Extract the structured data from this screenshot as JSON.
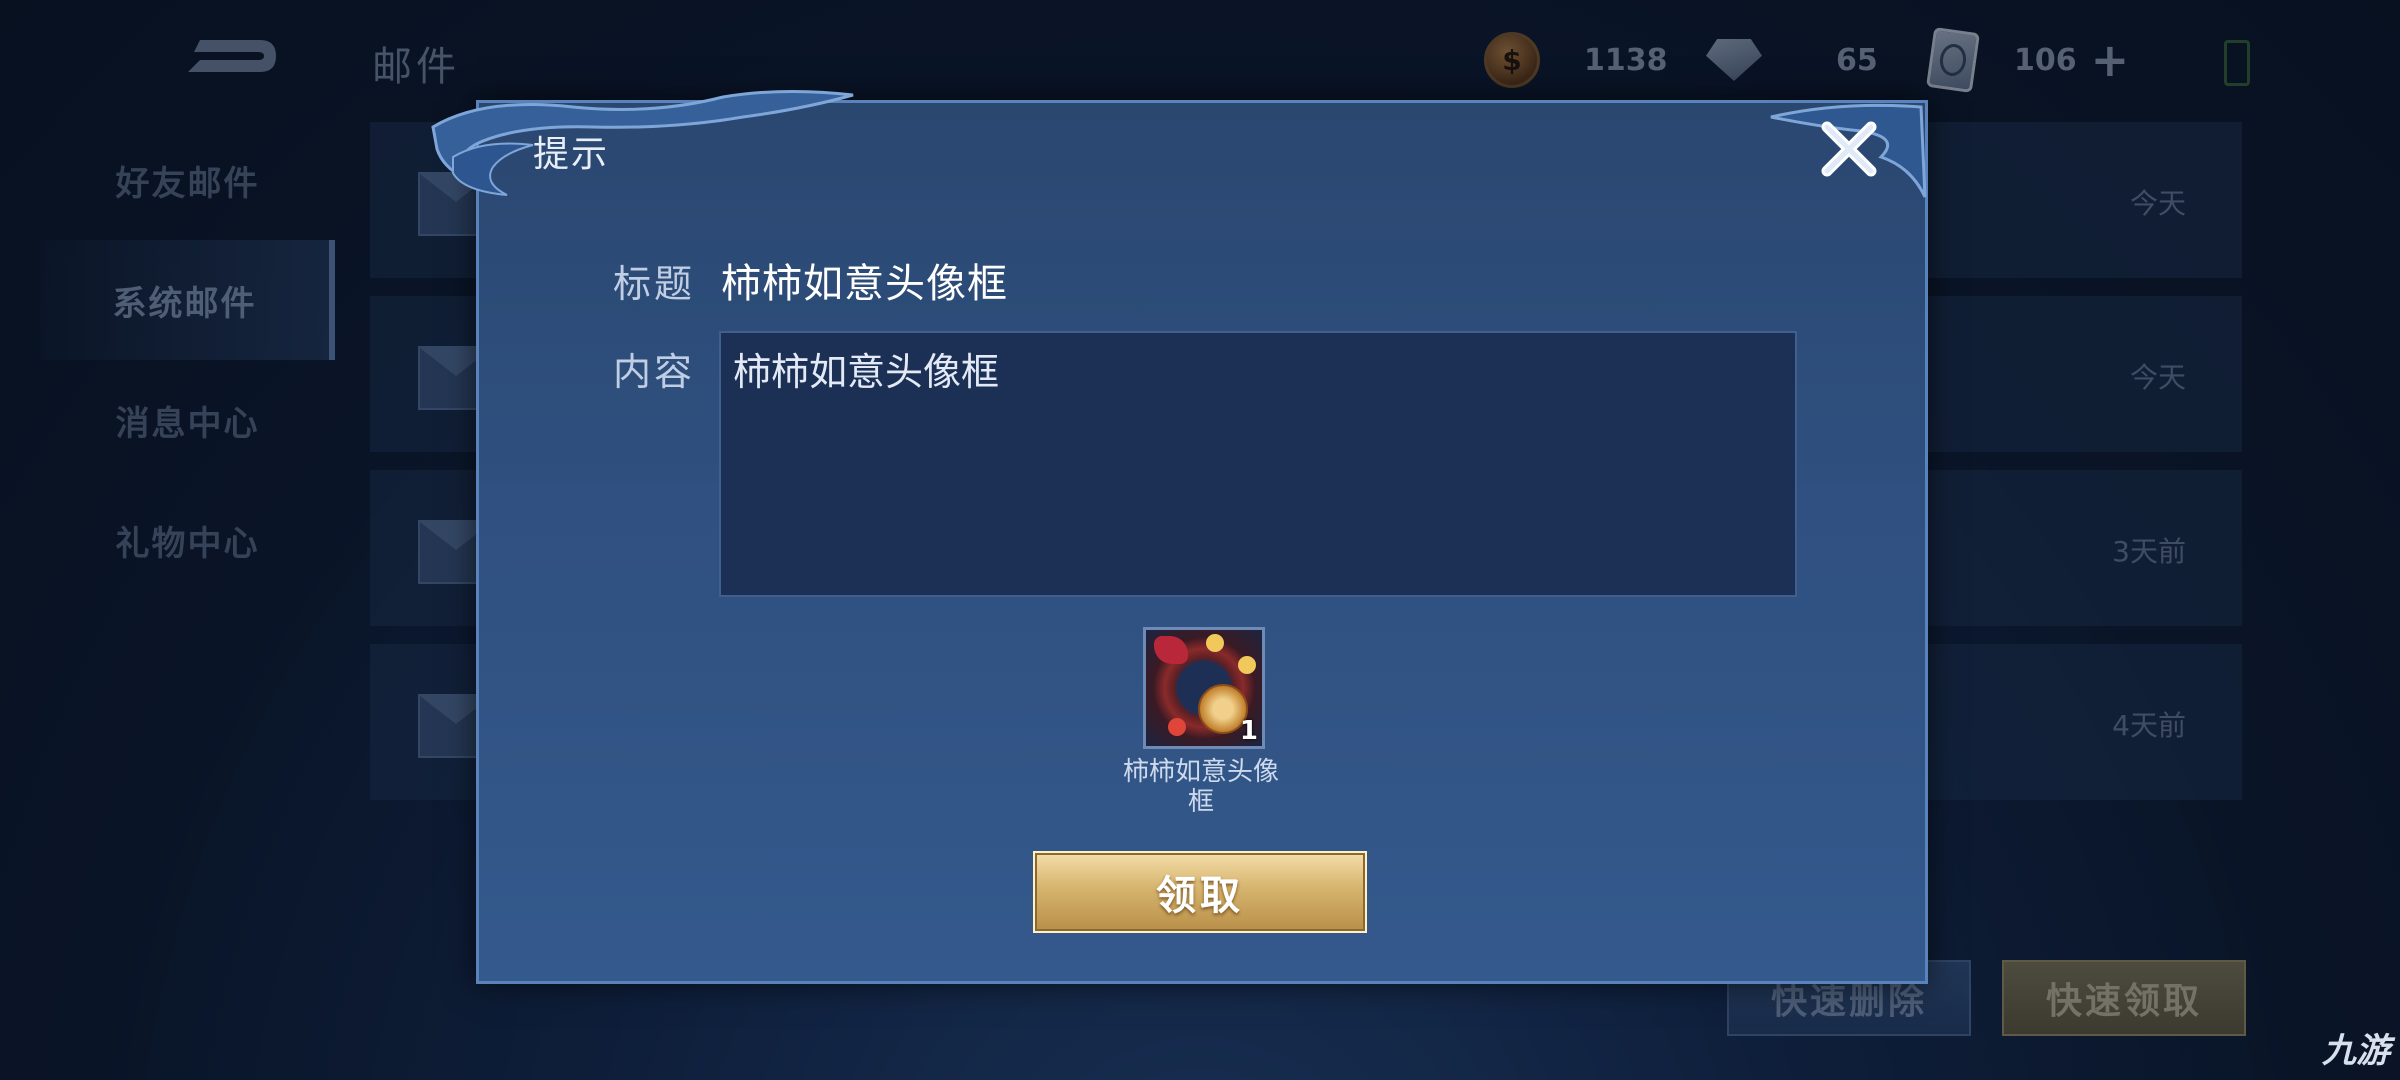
{
  "background": {
    "page_title": "邮件",
    "currencies": [
      {
        "icon": "coin-icon",
        "value": "1138"
      },
      {
        "icon": "diamond-icon",
        "value": "65"
      },
      {
        "icon": "ticket-icon",
        "value": "106"
      }
    ],
    "plus_label": "+",
    "sidebar": [
      {
        "label": "好友邮件"
      },
      {
        "label": "系统邮件"
      },
      {
        "label": "消息中心"
      },
      {
        "label": "礼物中心"
      }
    ],
    "mails": [
      {
        "date": "今天"
      },
      {
        "date": "今天"
      },
      {
        "date": "3天前"
      },
      {
        "date": "4天前"
      }
    ],
    "quick_delete": "快速删除",
    "quick_claim": "快速领取"
  },
  "dialog": {
    "title": "提示",
    "subject_label": "标题",
    "subject_value": "柿柿如意头像框",
    "content_label": "内容",
    "content_value": "柿柿如意头像框",
    "reward": {
      "name_line1": "柿柿如意头像",
      "name_line2": "框",
      "quantity": "1"
    },
    "claim_label": "领取"
  },
  "watermark": "九游",
  "colors": {
    "dialog_border": "#5b83bb",
    "claim_gold": "#d6b46e"
  }
}
